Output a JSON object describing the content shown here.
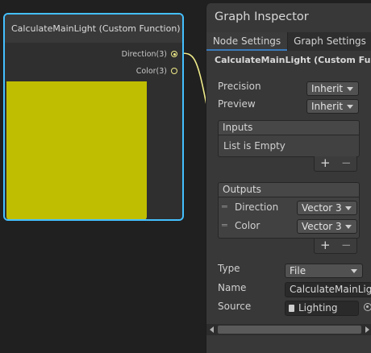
{
  "node": {
    "title": "CalculateMainLight (Custom Function)",
    "ports": [
      {
        "label": "Direction(3)",
        "connected": true
      },
      {
        "label": "Color(3)",
        "connected": false
      }
    ],
    "preview_color": "#c0be00",
    "port_color": "#f0ec8a",
    "selection_color": "#44c0ff"
  },
  "inspector": {
    "title": "Graph Inspector",
    "tabs": [
      {
        "label": "Node Settings",
        "active": true
      },
      {
        "label": "Graph Settings",
        "active": false
      }
    ],
    "node_name": "CalculateMainLight (Custom Function)",
    "precision": {
      "label": "Precision",
      "value": "Inherit"
    },
    "preview": {
      "label": "Preview",
      "value": "Inherit"
    },
    "inputs": {
      "header": "Inputs",
      "empty_text": "List is Empty",
      "add": "+",
      "remove": "−"
    },
    "outputs": {
      "header": "Outputs",
      "items": [
        {
          "name": "Direction",
          "type": "Vector 3"
        },
        {
          "name": "Color",
          "type": "Vector 3"
        }
      ],
      "add": "+",
      "remove": "−"
    },
    "type": {
      "label": "Type",
      "value": "File"
    },
    "name": {
      "label": "Name",
      "value": "CalculateMainLight"
    },
    "source": {
      "label": "Source",
      "value": "Lighting"
    }
  }
}
